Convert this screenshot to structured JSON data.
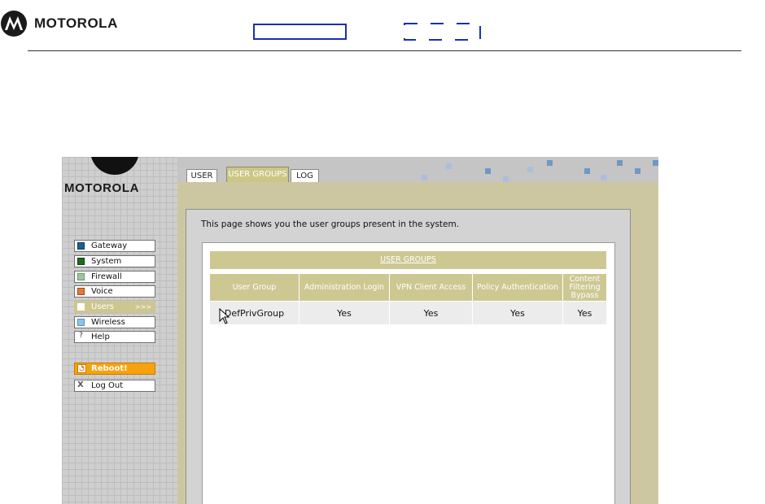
{
  "document": {
    "brand": "MOTOROLA"
  },
  "sidebar": {
    "brand": "MOTOROLA",
    "items": [
      {
        "label": "Gateway",
        "color": "#1f5f8b"
      },
      {
        "label": "System",
        "color": "#1e6b1e"
      },
      {
        "label": "Firewall",
        "color": "#9cc79c"
      },
      {
        "label": "Voice",
        "color": "#e07a3a"
      },
      {
        "label": "Users",
        "color": "#ffffff",
        "arrow": ">>>",
        "active": true
      },
      {
        "label": "Wireless",
        "color": "#8ec2e6"
      },
      {
        "label": "Help",
        "icon": "?"
      }
    ],
    "actions": [
      {
        "label": "Reboot!",
        "icon": "reboot-icon"
      },
      {
        "label": "Log Out",
        "icon": "X"
      }
    ]
  },
  "tabs": [
    "USER",
    "USER GROUPS",
    "LOG"
  ],
  "active_tab": "USER GROUPS",
  "intro_text": "This page shows you the user groups present in the system.",
  "table": {
    "title": "USER GROUPS",
    "headers": [
      "User Group",
      "Administration Login",
      "VPN Client Access",
      "Policy Authentication",
      "Content Filtering Bypass"
    ],
    "rows": [
      [
        "DefPrivGroup",
        "Yes",
        "Yes",
        "Yes",
        "Yes"
      ]
    ]
  },
  "colors": {
    "accent": "#cdc892",
    "reboot": "#f7a20d",
    "header_box": "#1a2fb0"
  }
}
